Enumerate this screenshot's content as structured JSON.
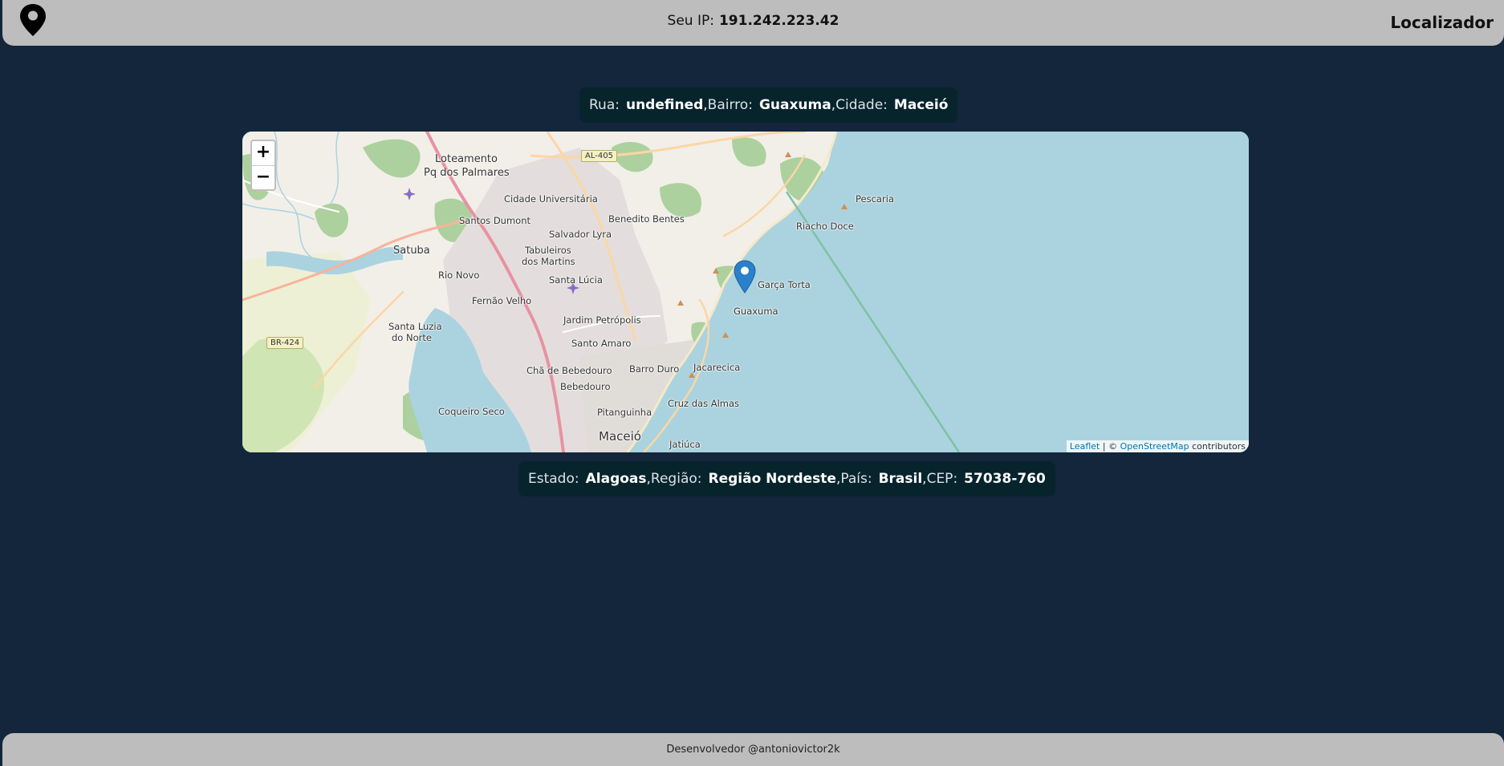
{
  "header": {
    "ip_label": "Seu IP:",
    "ip_value": "191.242.223.42",
    "brand": "Localizador",
    "logo_icon": "location-pin-icon"
  },
  "address": {
    "rua_label": "Rua:",
    "rua_value": "undefined",
    "bairro_label": ",Bairro:",
    "bairro_value": "Guaxuma",
    "cidade_label": ",Cidade:",
    "cidade_value": "Maceió"
  },
  "location": {
    "estado_label": "Estado:",
    "estado_value": "Alagoas",
    "regiao_label": ",Região:",
    "regiao_value": "Região Nordeste",
    "pais_label": ",País:",
    "pais_value": "Brasil",
    "cep_label": ",CEP:",
    "cep_value": "57038-760"
  },
  "map": {
    "zoom_in": "+",
    "zoom_out": "−",
    "attribution_leaflet": "Leaflet",
    "attribution_sep": " | © ",
    "attribution_osm": "OpenStreetMap",
    "attribution_contrib": " contributors",
    "shields": [
      "AL-405",
      "BR-424"
    ],
    "places": {
      "loteamento": "Loteamento",
      "pq_palmares": "Pq dos Palmares",
      "cidade_universitaria": "Cidade Universitária",
      "santos_dumont": "Santos Dumont",
      "benedito_bentes": "Benedito Bentes",
      "salvador_lyra": "Salvador Lyra",
      "satuba": "Satuba",
      "tabuleiros": "Tabuleiros",
      "dos_martins": "dos Martins",
      "rio_novo": "Rio Novo",
      "santa_lucia": "Santa Lúcia",
      "fernao_velho": "Fernão Velho",
      "jardim_petropolis": "Jardim Petrópolis",
      "santa_luzia": "Santa Luzia",
      "do_norte": "do Norte",
      "santo_amaro": "Santo Amaro",
      "cha_bebedouro": "Chã de Bebedouro",
      "bebedouro": "Bebedouro",
      "barro_duro": "Barro Duro",
      "jacarecica": "Jacarecica",
      "cruz_das_almas": "Cruz das Almas",
      "pitanguinha": "Pitanguinha",
      "coqueiro_seco": "Coqueiro Seco",
      "maceio": "Maceió",
      "jatiuca": "Jatiúca",
      "garca_torta": "Garça Torta",
      "guaxuma": "Guaxuma",
      "riacho_doce": "Riacho Doce",
      "pescaria": "Pescaria"
    },
    "marker_icon": "map-marker-icon"
  },
  "footer": {
    "text": "Desenvolvedor @antoniovictor2k"
  },
  "colors": {
    "background": "#13263b",
    "bar": "#bdbdbd",
    "info_box": "#07242d",
    "sea": "#aad3df"
  }
}
